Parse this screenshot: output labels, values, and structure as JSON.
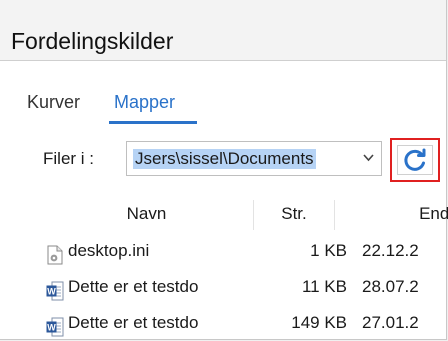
{
  "window": {
    "title": "Fordelingskilder"
  },
  "tabs": [
    {
      "label": "Kurver",
      "active": false
    },
    {
      "label": "Mapper",
      "active": true
    }
  ],
  "files": {
    "label": "Filer i :",
    "path_value": "Jsers\\sissel\\Documents",
    "dropdown_icon": "chevron-down-icon",
    "refresh_icon": "refresh-icon"
  },
  "table": {
    "columns": [
      "Navn",
      "Str.",
      "Endr"
    ],
    "rows": [
      {
        "icon": "settings-file-icon",
        "name": "desktop.ini",
        "size": "1 KB",
        "date": "22.12.2"
      },
      {
        "icon": "word-document-icon",
        "name": "Dette er et testdo",
        "size": "11 KB",
        "date": "28.07.2"
      },
      {
        "icon": "word-document-icon",
        "name": "Dette er et testdo",
        "size": "149 KB",
        "date": "27.01.2"
      }
    ]
  },
  "colors": {
    "accent": "#2a72c9",
    "highlight": "#e02020",
    "selection": "#b6d3f5"
  }
}
